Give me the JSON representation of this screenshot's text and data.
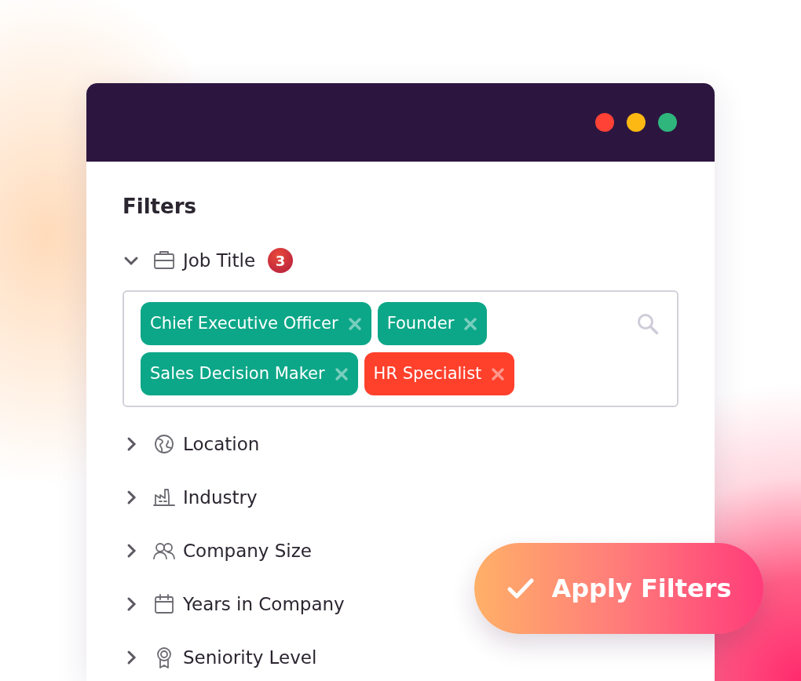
{
  "window": {
    "controls": [
      {
        "color": "#ff4136"
      },
      {
        "color": "#fdb813"
      },
      {
        "color": "#2fb67c"
      }
    ]
  },
  "title": "Filters",
  "filters": [
    {
      "label": "Job Title",
      "expanded": true,
      "count": "3",
      "tags": [
        {
          "label": "Chief Executive Officer",
          "color": "#0ca788"
        },
        {
          "label": "Founder",
          "color": "#0ca788"
        },
        {
          "label": "Sales Decision Maker",
          "color": "#0ca788"
        },
        {
          "label": "HR Specialist",
          "color": "#ff412c"
        }
      ]
    },
    {
      "label": "Location",
      "expanded": false
    },
    {
      "label": "Industry",
      "expanded": false
    },
    {
      "label": "Company Size",
      "expanded": false
    },
    {
      "label": "Years in Company",
      "expanded": false
    },
    {
      "label": "Seniority Level",
      "expanded": false
    }
  ],
  "apply_button": "Apply Filters"
}
